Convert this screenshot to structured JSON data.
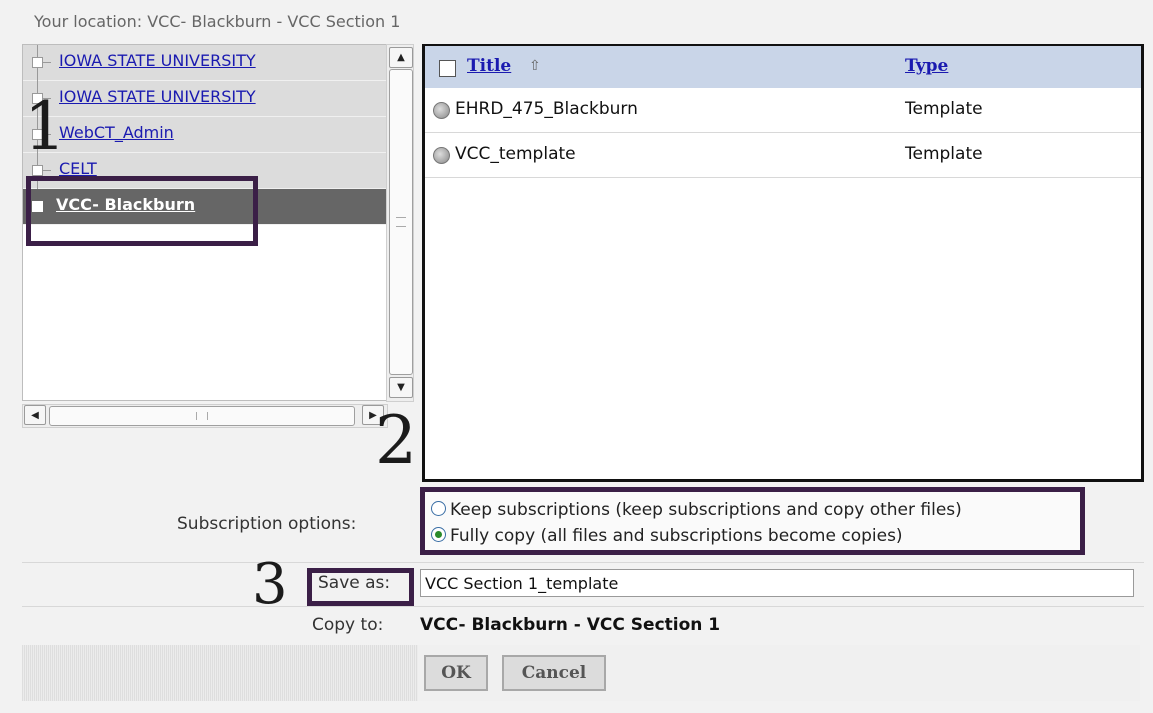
{
  "location": "Your location: VCC- Blackburn - VCC Section 1",
  "tree": {
    "items": [
      {
        "label": "IOWA STATE UNIVERSITY"
      },
      {
        "label": "IOWA STATE UNIVERSITY"
      },
      {
        "label": "WebCT_Admin"
      },
      {
        "label": "CELT"
      },
      {
        "label": "VCC- Blackburn",
        "selected": true
      }
    ]
  },
  "scrollbars": {
    "up_icon": "▲",
    "down_icon": "▼",
    "left_icon": "◀",
    "right_icon": "▶"
  },
  "table": {
    "columns": {
      "title": "Title",
      "sort_icon": "⇧",
      "type": "Type"
    },
    "rows": [
      {
        "title": "EHRD_475_Blackburn",
        "type": "Template"
      },
      {
        "title": "VCC_template",
        "type": "Template"
      }
    ]
  },
  "form": {
    "subscription_label": "Subscription options:",
    "options": [
      {
        "label": "Keep subscriptions (keep subscriptions and copy other files)",
        "selected": false
      },
      {
        "label": "Fully copy (all files and subscriptions become copies)",
        "selected": true
      }
    ],
    "save_as_label": "Save as:",
    "save_as_value": "VCC Section 1_template",
    "copy_to_label": "Copy to:",
    "copy_to_value": "VCC- Blackburn - VCC Section 1",
    "ok_label": "OK",
    "cancel_label": "Cancel"
  },
  "annotations": {
    "one": "1",
    "two": "2",
    "three": "3"
  },
  "colors": {
    "annotation_box": "#3b1f47",
    "header_bg": "#c9d5e8",
    "selected_bg": "#666666",
    "link": "#1a1ab0"
  }
}
